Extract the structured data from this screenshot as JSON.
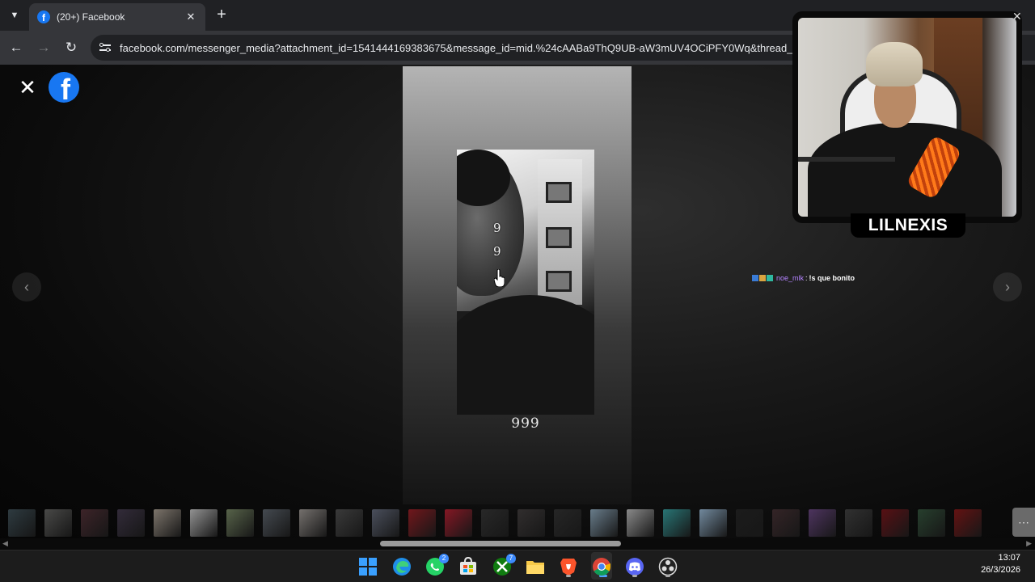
{
  "browser": {
    "tab_title": "(20+) Facebook",
    "tab_close": "✕",
    "new_tab": "+",
    "url": "facebook.com/messenger_media?attachment_id=1541444169383675&message_id=mid.%24cAABa9ThQ9UB-aW3mUV4OCiPFY0Wq&thread_id="
  },
  "viewer": {
    "close_label": "✕",
    "logo_letter": "f",
    "prev_label": "‹",
    "next_label": "›",
    "photo_digits": [
      "9",
      "9"
    ],
    "caption": "999",
    "thumbnail_colors": [
      "#38484f",
      "#5a5a58",
      "#4a2b31",
      "#3d3446",
      "#9a9084",
      "#b5b5b5",
      "#6b7a5a",
      "#535a62",
      "#8f8a86",
      "#464646",
      "#5a6070",
      "#8b1a20",
      "#a31a2a",
      "#2f2f2f",
      "#3a3636",
      "#2c2c2c",
      "#7f98aa",
      "#a8a8a8",
      "#2f8f8f",
      "#8aa8c2",
      "#1f1f1f",
      "#3e2a2d",
      "#5e3e74",
      "#3a3a3a",
      "#6b1116",
      "#2e4c36",
      "#7a1414"
    ]
  },
  "stream": {
    "streamer_name": "LILNEXIS",
    "chat": {
      "user": "noe_mlk",
      "separator": ":",
      "message": "!s que bonito"
    }
  },
  "taskbar": {
    "whatsapp_badge": "2",
    "xbox_badge": "7",
    "time": "13:07",
    "date": "26/3/2026"
  }
}
